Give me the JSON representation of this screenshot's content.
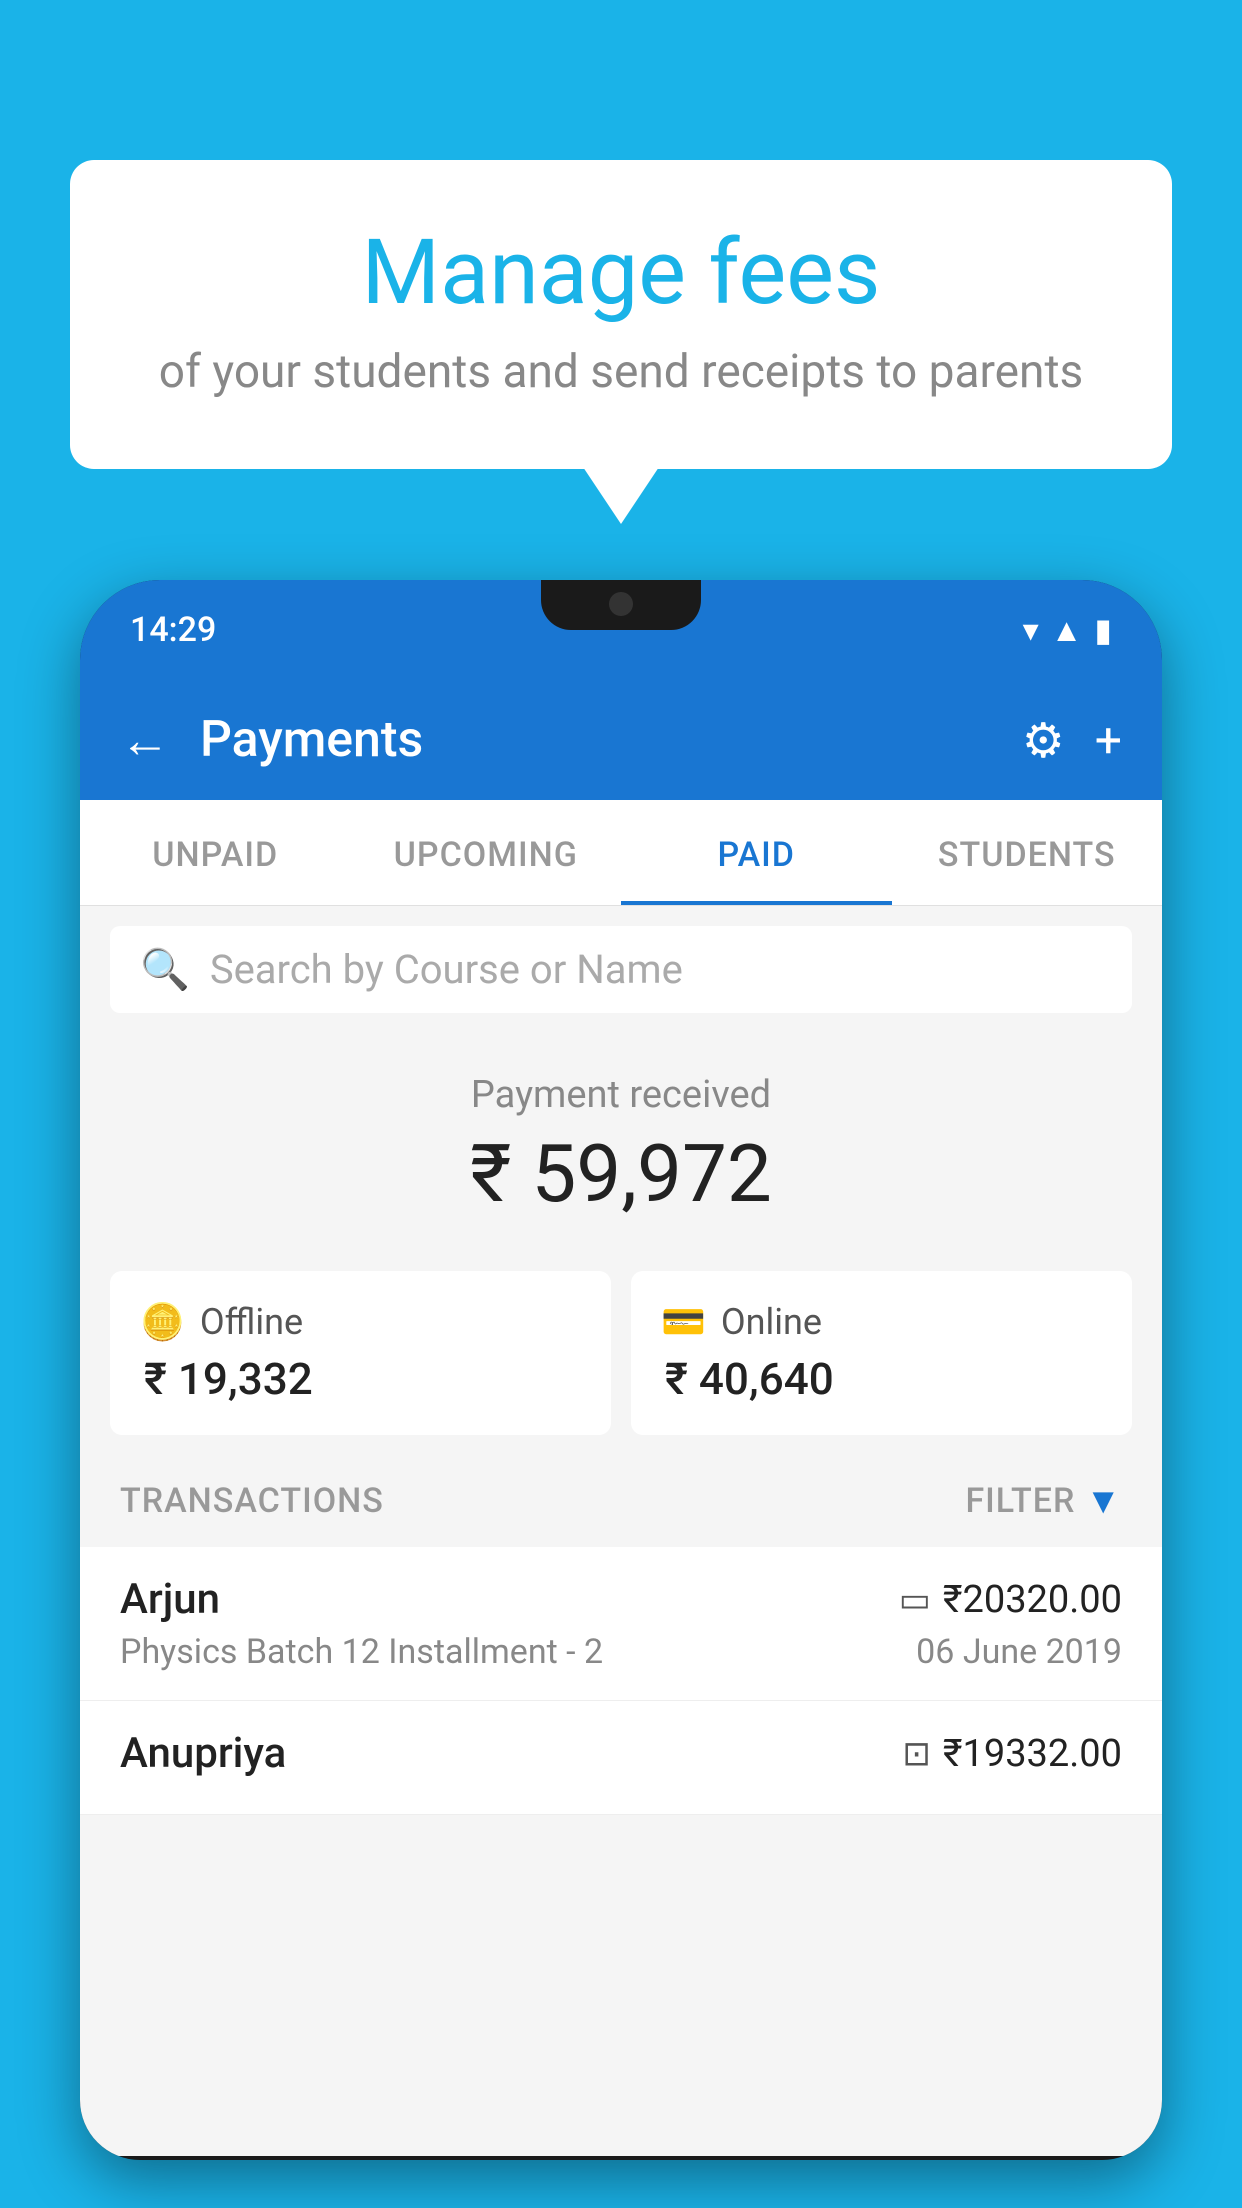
{
  "background_color": "#1ab3e8",
  "speech_bubble": {
    "title": "Manage fees",
    "subtitle": "of your students and send receipts to parents"
  },
  "status_bar": {
    "time": "14:29",
    "icons": [
      "wifi",
      "signal",
      "battery"
    ]
  },
  "app_bar": {
    "title": "Payments",
    "back_label": "←",
    "settings_label": "⚙",
    "add_label": "+"
  },
  "tabs": [
    {
      "id": "unpaid",
      "label": "UNPAID",
      "active": false
    },
    {
      "id": "upcoming",
      "label": "UPCOMING",
      "active": false
    },
    {
      "id": "paid",
      "label": "PAID",
      "active": true
    },
    {
      "id": "students",
      "label": "STUDENTS",
      "active": false
    }
  ],
  "search": {
    "placeholder": "Search by Course or Name"
  },
  "payment_summary": {
    "label": "Payment received",
    "amount": "₹ 59,972",
    "offline": {
      "label": "Offline",
      "amount": "₹ 19,332"
    },
    "online": {
      "label": "Online",
      "amount": "₹ 40,640"
    }
  },
  "transactions": {
    "label": "TRANSACTIONS",
    "filter_label": "FILTER",
    "items": [
      {
        "name": "Arjun",
        "course": "Physics Batch 12 Installment - 2",
        "amount": "₹20320.00",
        "date": "06 June 2019",
        "payment_type": "card"
      },
      {
        "name": "Anupriya",
        "course": "",
        "amount": "₹19332.00",
        "date": "",
        "payment_type": "offline"
      }
    ]
  }
}
